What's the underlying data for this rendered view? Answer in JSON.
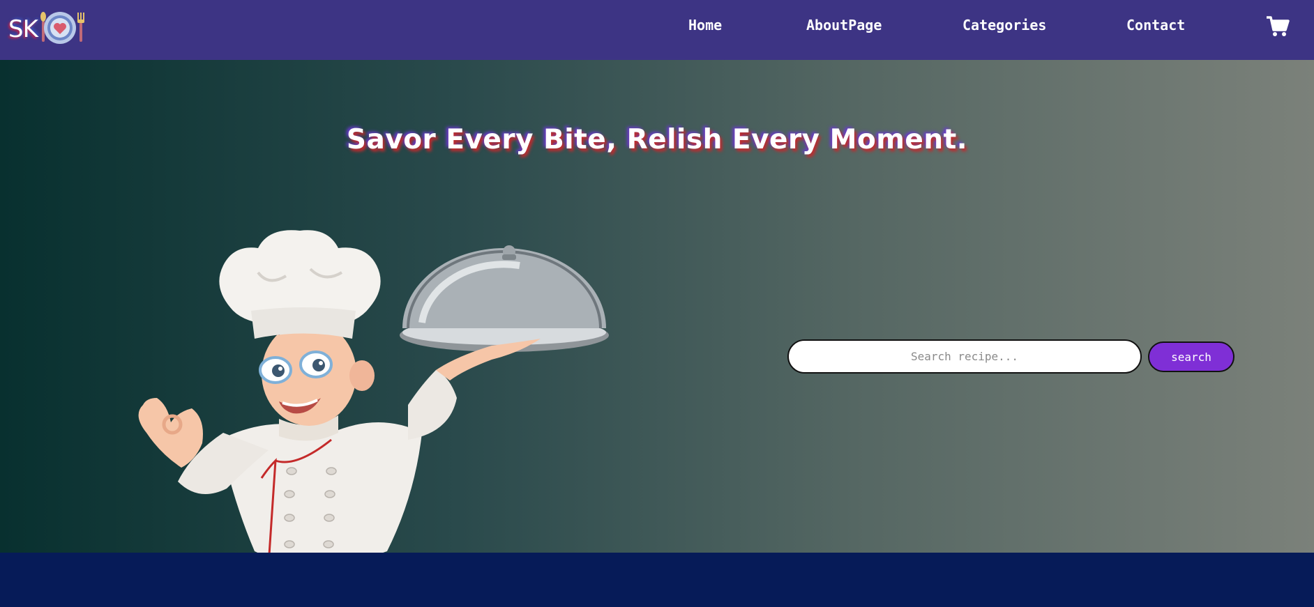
{
  "brand": {
    "logo_text": "SK",
    "accent": "#3d3484"
  },
  "nav": {
    "items": [
      {
        "label": "Home"
      },
      {
        "label": "AboutPage"
      },
      {
        "label": "Categories"
      },
      {
        "label": "Contact"
      }
    ],
    "cart_icon": "shopping-cart-icon"
  },
  "hero": {
    "title": "Savor Every Bite, Relish Every Moment.",
    "illustration": "chef-illustration"
  },
  "search": {
    "placeholder": "Search recipe...",
    "value": "",
    "button_label": "search",
    "button_color": "#7f2fd6"
  },
  "footer": {
    "background": "#061b58"
  }
}
